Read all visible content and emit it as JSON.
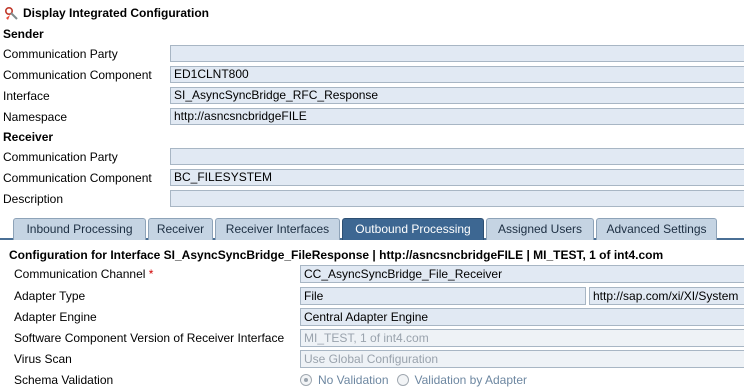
{
  "window": {
    "title": "Display Integrated Configuration"
  },
  "sender": {
    "heading": "Sender",
    "fields": [
      {
        "label": "Communication Party",
        "value": ""
      },
      {
        "label": "Communication Component",
        "value": "ED1CLNT800"
      },
      {
        "label": "Interface",
        "value": "SI_AsyncSyncBridge_RFC_Response"
      },
      {
        "label": "Namespace",
        "value": "http://asncsncbridgeFILE"
      }
    ]
  },
  "receiver": {
    "heading": "Receiver",
    "fields": [
      {
        "label": "Communication Party",
        "value": ""
      },
      {
        "label": "Communication Component",
        "value": "BC_FILESYSTEM"
      },
      {
        "label": "Description",
        "value": ""
      }
    ]
  },
  "tabs": [
    {
      "label": "Inbound Processing",
      "active": false
    },
    {
      "label": "Receiver",
      "active": false
    },
    {
      "label": "Receiver Interfaces",
      "active": false
    },
    {
      "label": "Outbound Processing",
      "active": true
    },
    {
      "label": "Assigned Users",
      "active": false
    },
    {
      "label": "Advanced Settings",
      "active": false
    }
  ],
  "outbound": {
    "heading": "Configuration for Interface SI_AsyncSyncBridge_FileResponse | http://asncsncbridgeFILE | MI_TEST, 1 of int4.com",
    "communication_channel": {
      "label": "Communication Channel",
      "required_mark": "*",
      "value": "CC_AsyncSyncBridge_File_Receiver"
    },
    "adapter_type": {
      "label": "Adapter Type",
      "value": "File",
      "namespace": "http://sap.com/xi/XI/System"
    },
    "adapter_engine": {
      "label": "Adapter Engine",
      "value": "Central Adapter Engine"
    },
    "swcv": {
      "label": "Software Component Version of Receiver Interface",
      "value": "MI_TEST, 1 of int4.com"
    },
    "virus_scan": {
      "label": "Virus Scan",
      "value": "Use Global Configuration"
    },
    "schema_validation": {
      "label": "Schema Validation",
      "options": [
        "No Validation",
        "Validation by Adapter"
      ],
      "selected": "No Validation"
    }
  }
}
